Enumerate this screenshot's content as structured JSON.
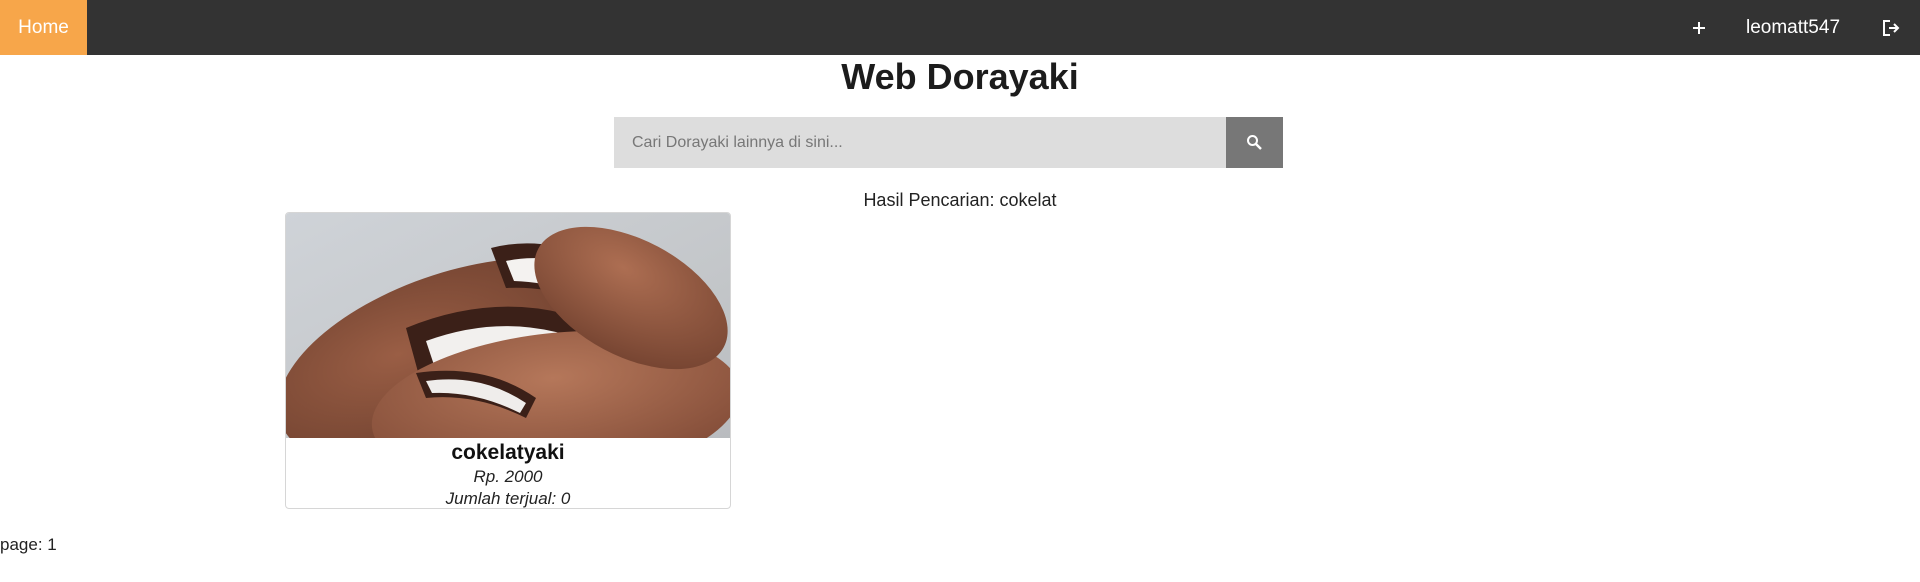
{
  "navbar": {
    "home_label": "Home",
    "add_icon": "plus-icon",
    "username": "leomatt547",
    "logout_icon": "logout-icon"
  },
  "page": {
    "title": "Web Dorayaki"
  },
  "search": {
    "placeholder": "Cari Dorayaki lainnya di sini...",
    "value": "",
    "button_icon": "search-icon"
  },
  "results": {
    "label": "Hasil Pencarian: cokelat",
    "items": [
      {
        "name": "cokelatyaki",
        "price": "Rp. 2000",
        "sold": "Jumlah terjual: 0",
        "image": "chocolate dorayaki photo"
      }
    ]
  },
  "pagination": {
    "label": "page: 1"
  },
  "colors": {
    "navbar_bg": "#333333",
    "home_active_bg": "#f7a64a",
    "search_bg": "#dddddd",
    "search_button_bg": "#777777"
  }
}
